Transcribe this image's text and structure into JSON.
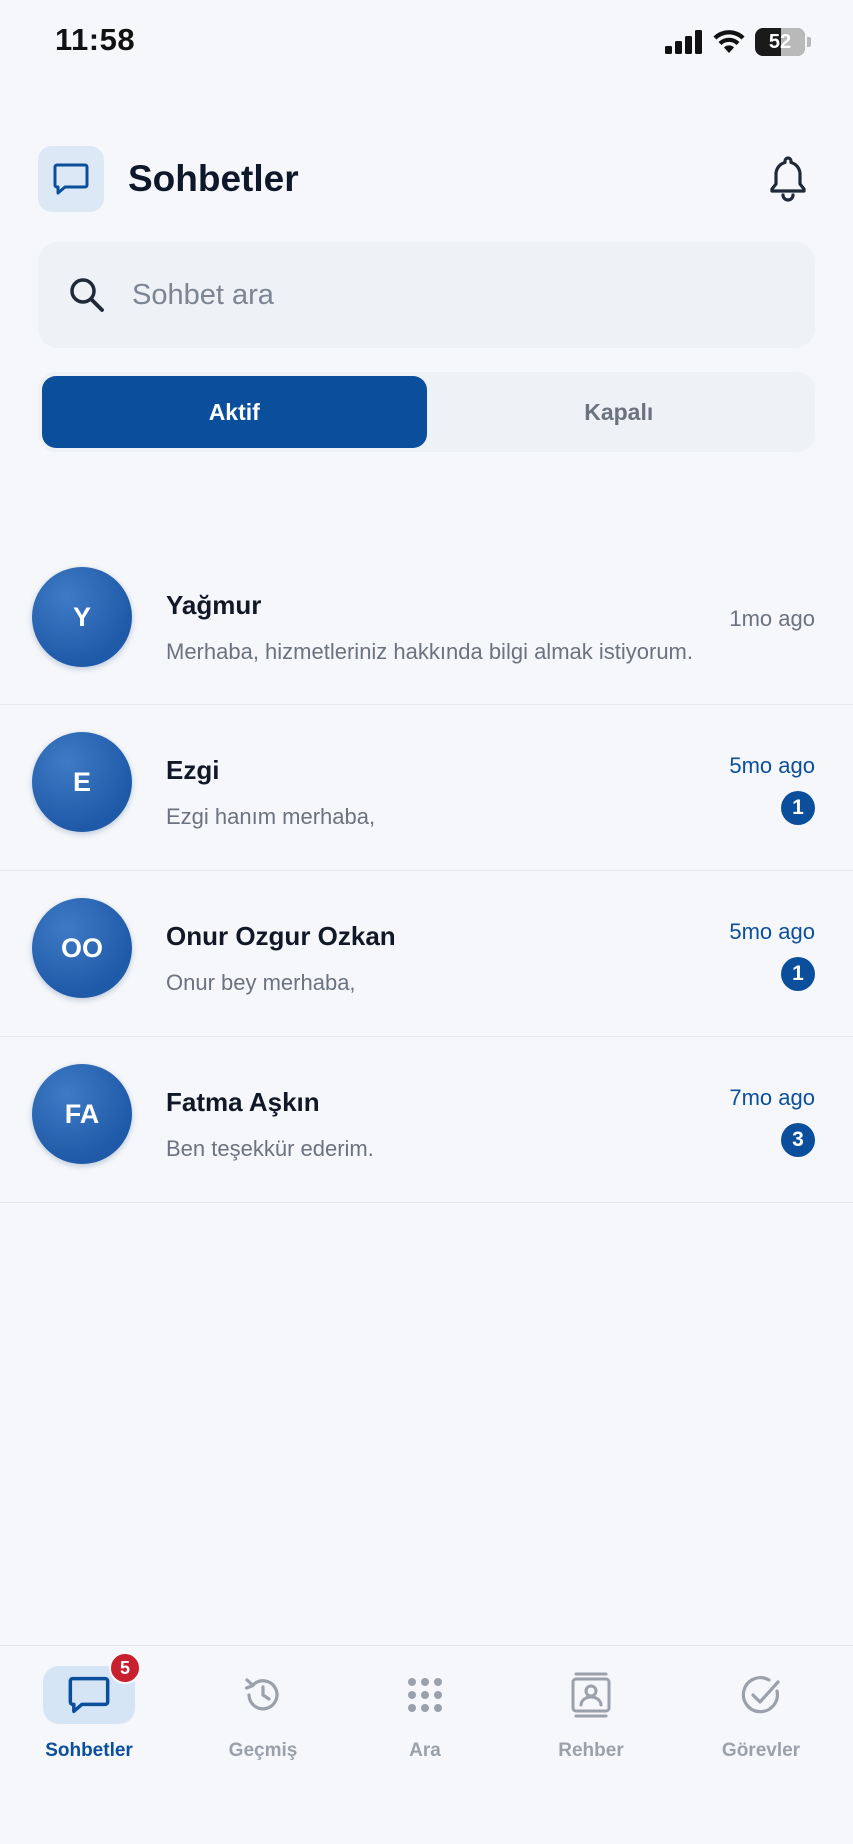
{
  "status_bar": {
    "time": "11:58",
    "battery": "52"
  },
  "header": {
    "title": "Sohbetler"
  },
  "search": {
    "placeholder": "Sohbet ara"
  },
  "segments": {
    "active": "Aktif",
    "closed": "Kapalı"
  },
  "chats": [
    {
      "initials": "Y",
      "name": "Yağmur",
      "preview": "Merhaba, hizmetleriniz hakkında bilgi almak istiyorum.",
      "time": "1mo ago",
      "unread": null
    },
    {
      "initials": "E",
      "name": "Ezgi",
      "preview": "Ezgi hanım merhaba,",
      "time": "5mo ago",
      "unread": "1"
    },
    {
      "initials": "OO",
      "name": "Onur Ozgur Ozkan",
      "preview": "Onur bey merhaba,",
      "time": "5mo ago",
      "unread": "1"
    },
    {
      "initials": "FA",
      "name": "Fatma Aşkın",
      "preview": "Ben teşekkür ederim.",
      "time": "7mo ago",
      "unread": "3"
    }
  ],
  "tabbar": {
    "chats": {
      "label": "Sohbetler",
      "badge": "5"
    },
    "history": {
      "label": "Geçmiş"
    },
    "dial": {
      "label": "Ara"
    },
    "contacts": {
      "label": "Rehber"
    },
    "tasks": {
      "label": "Görevler"
    }
  },
  "colors": {
    "accent": "#0b4f9c",
    "badge_red": "#c8202f",
    "background": "#f5f7fa"
  },
  "icons": {
    "header": "chat-bubble-icon",
    "bell": "bell-icon",
    "search": "search-icon",
    "tabs": [
      "chat-bubble-icon",
      "history-icon",
      "keypad-icon",
      "contact-card-icon",
      "check-circle-icon"
    ]
  }
}
